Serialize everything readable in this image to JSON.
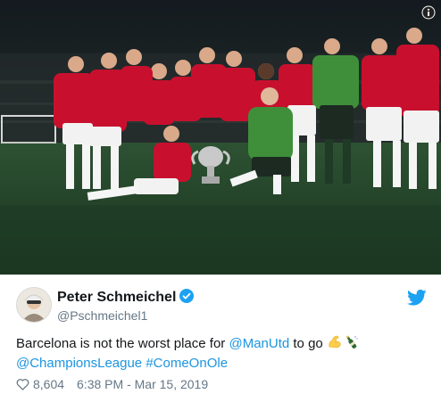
{
  "tweet": {
    "author": {
      "name": "Peter Schmeichel",
      "handle": "@Pschmeichel1",
      "verified_icon": "verified-badge-icon"
    },
    "text": {
      "part1": "Barcelona is not the worst place for ",
      "mention1": "@ManUtd",
      "part2": " to go",
      "mention2": "@ChampionsLeague",
      "hashtag": "#ComeOnOle",
      "emojis": [
        "flexed-biceps-icon",
        "champagne-bottle-icon"
      ]
    },
    "likes": "8,604",
    "timestamp": "6:38 PM - Mar 15, 2019"
  },
  "colors": {
    "link": "#1b95e0",
    "secondary_text": "#657786",
    "kit_red": "#c8102e",
    "keeper_green": "#3f8f3a",
    "pitch": "#24452b"
  }
}
